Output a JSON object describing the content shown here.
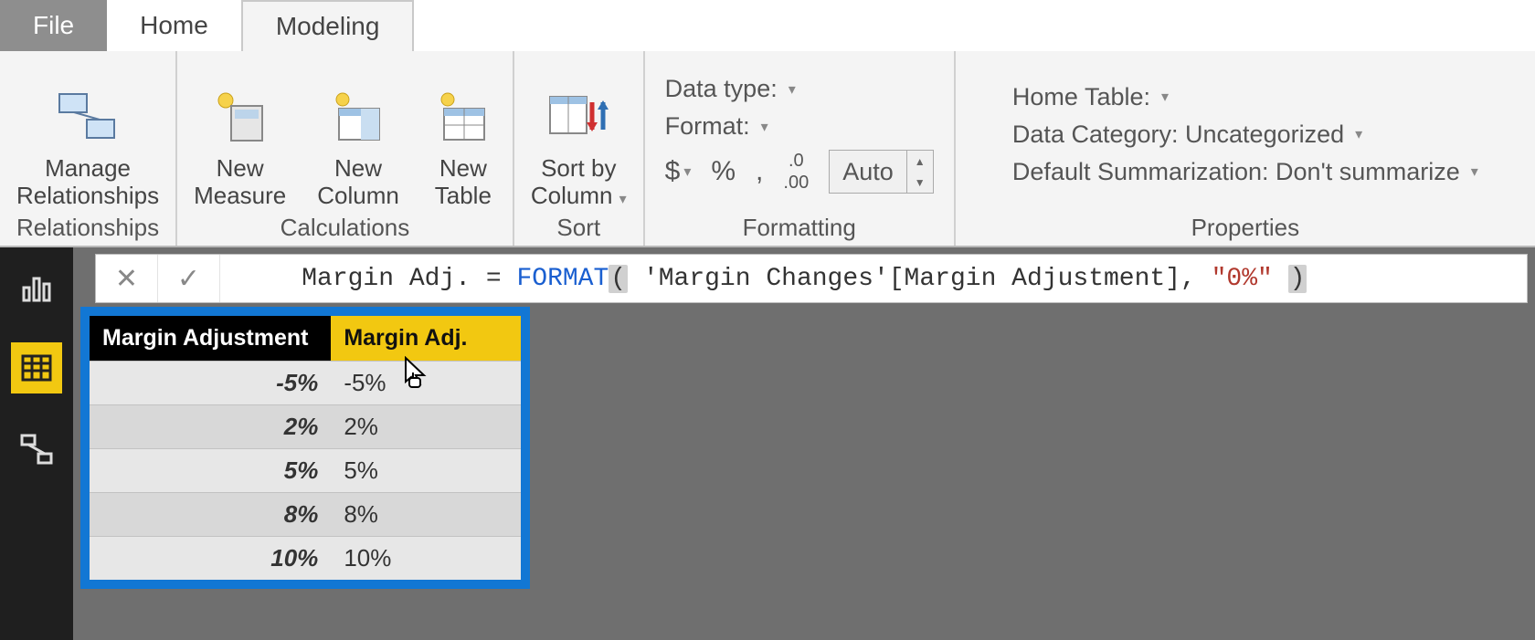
{
  "tabs": {
    "file": "File",
    "home": "Home",
    "modeling": "Modeling"
  },
  "ribbon": {
    "relationships": {
      "manage": "Manage\nRelationships",
      "group": "Relationships"
    },
    "calculations": {
      "measure": "New\nMeasure",
      "column": "New\nColumn",
      "table": "New\nTable",
      "group": "Calculations"
    },
    "sort": {
      "sortby": "Sort by\nColumn",
      "group": "Sort"
    },
    "formatting": {
      "datatype_label": "Data type:",
      "format_label": "Format:",
      "currency": "$",
      "percent": "%",
      "thousands": ",",
      "decimals_icon": ".00",
      "auto": "Auto",
      "group": "Formatting"
    },
    "properties": {
      "home_table": "Home Table:",
      "data_category": "Data Category: Uncategorized",
      "default_summarization": "Default Summarization: Don't summarize",
      "group": "Properties"
    }
  },
  "formula": {
    "lhs": "Margin Adj. = ",
    "fn": "FORMAT",
    "open": "(",
    "arg1": " 'Margin Changes'[Margin Adjustment], ",
    "str": "\"0%\"",
    "space": " ",
    "close": ")"
  },
  "table": {
    "headers": [
      "Margin Adjustment",
      "Margin Adj."
    ],
    "rows": [
      {
        "adj": "-5%",
        "fmt": "-5%"
      },
      {
        "adj": "2%",
        "fmt": "2%"
      },
      {
        "adj": "5%",
        "fmt": "5%"
      },
      {
        "adj": "8%",
        "fmt": "8%"
      },
      {
        "adj": "10%",
        "fmt": "10%"
      }
    ]
  }
}
